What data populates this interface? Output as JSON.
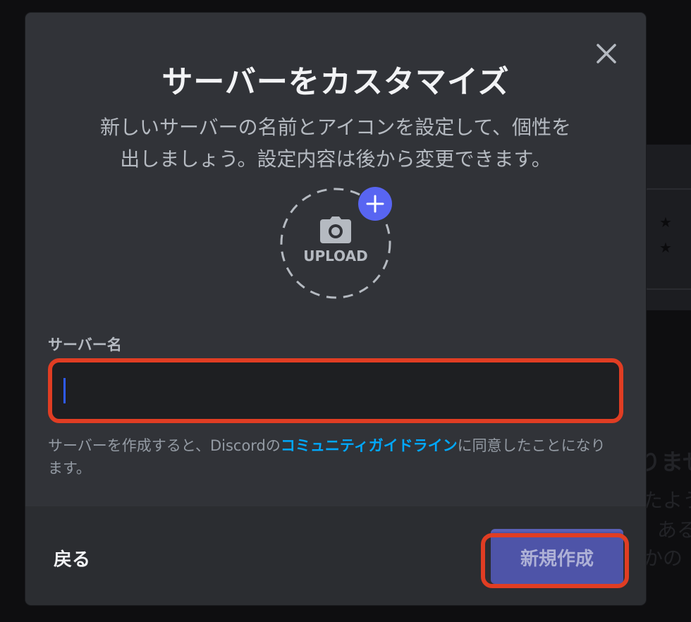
{
  "modal": {
    "title": "サーバーをカスタマイズ",
    "subtitle_line1": "新しいサーバーの名前とアイコンを設定して、個性を",
    "subtitle_line2": "出しましょう。設定内容は後から変更できます。",
    "upload_label": "UPLOAD",
    "field_label": "サーバー名",
    "server_name_value": "",
    "terms_prefix": "サーバーを作成すると、Discordの",
    "terms_link": "コミュニティガイドライン",
    "terms_suffix": "に同意したことになります。",
    "back_label": "戻る",
    "create_label": "新規作成"
  },
  "background": {
    "text_line1": "りませ",
    "text_line2": "たよう",
    "text_line3": "ある",
    "text_line4": "かの"
  },
  "icons": {
    "close": "close-icon",
    "camera": "camera-icon",
    "plus": "plus-icon"
  },
  "colors": {
    "modal_bg": "#313338",
    "footer_bg": "#2b2d31",
    "input_bg": "#1e1f22",
    "accent": "#5865f2",
    "link": "#00a8fc",
    "highlight": "#e03d23"
  }
}
